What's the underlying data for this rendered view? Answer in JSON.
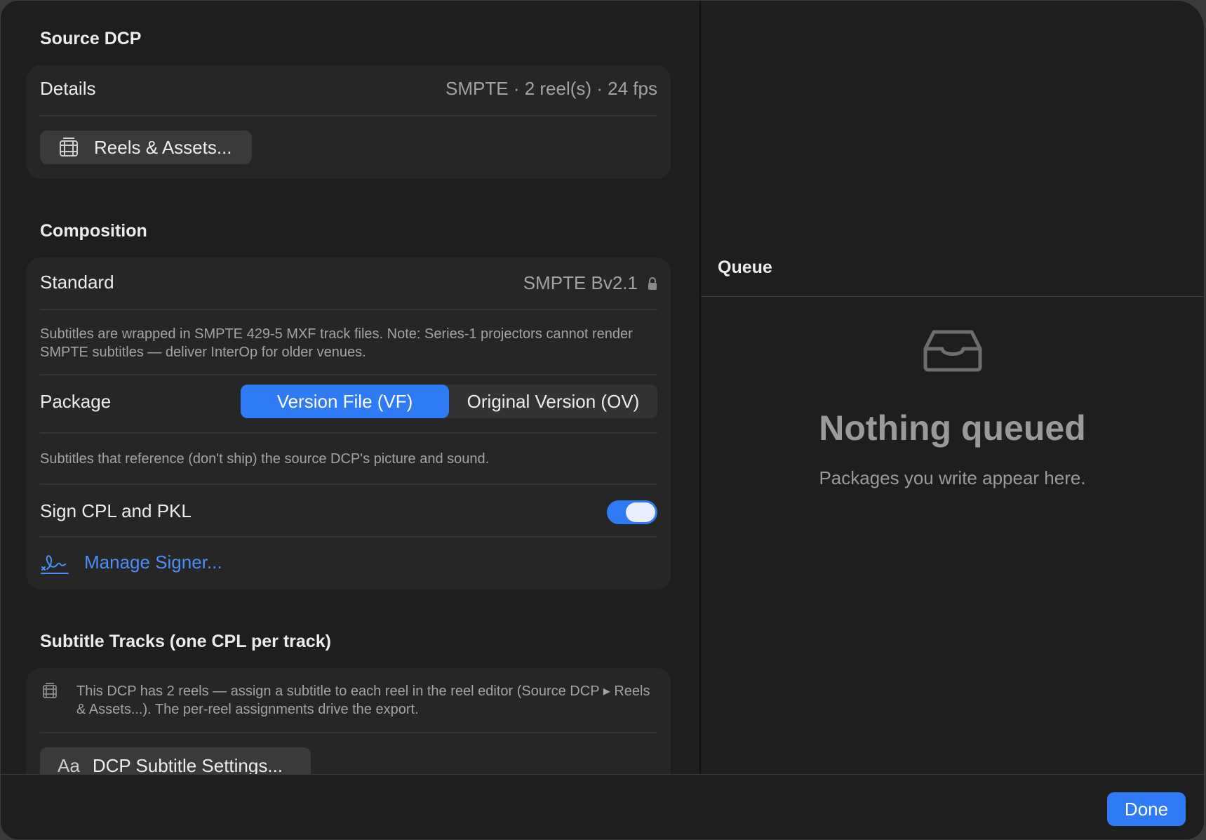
{
  "source_dcp": {
    "title": "Source DCP",
    "details_label": "Details",
    "details_value": "SMPTE · 2 reel(s) · 24 fps",
    "reels_button": "Reels & Assets..."
  },
  "composition": {
    "title": "Composition",
    "standard_label": "Standard",
    "standard_value": "SMPTE Bv2.1",
    "standard_note": "Subtitles are wrapped in SMPTE 429-5 MXF track files. Note: Series-1 projectors cannot render SMPTE subtitles — deliver InterOp for older venues.",
    "package_label": "Package",
    "package_options": [
      "Version File (VF)",
      "Original Version (OV)"
    ],
    "package_selected": "Version File (VF)",
    "package_note": "Subtitles that reference (don't ship) the source DCP's picture and sound.",
    "sign_label": "Sign CPL and PKL",
    "sign_enabled": true,
    "manage_signer": "Manage Signer..."
  },
  "subtitle_tracks": {
    "title": "Subtitle Tracks (one CPL per track)",
    "info": "This DCP has 2 reels — assign a subtitle to each reel in the reel editor (Source DCP ▸ Reels & Assets...). The per-reel assignments drive the export.",
    "settings_icon_text": "Aa",
    "settings_button": "DCP Subtitle Settings..."
  },
  "queue": {
    "title": "Queue",
    "empty_title": "Nothing queued",
    "empty_subtitle": "Packages you write appear here."
  },
  "footer": {
    "done": "Done"
  },
  "colors": {
    "accent": "#2f7bf5",
    "link": "#4c8ef7"
  },
  "icons": [
    "film-icon",
    "lock-icon",
    "signature-icon",
    "tray-icon"
  ]
}
